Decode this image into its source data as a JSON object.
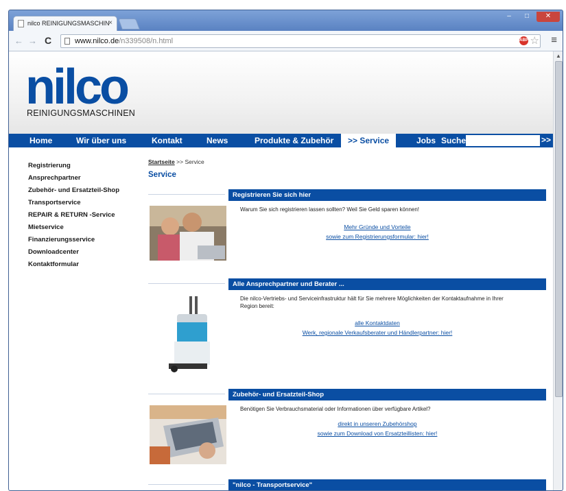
{
  "browser": {
    "tab_title": "nilco REINIGUNGSMASCHIN",
    "tab_close": "×",
    "url_host": "www.nilco.de",
    "url_path": "/n339508/n.html",
    "window_min": "–",
    "window_max": "□",
    "window_close": "✕"
  },
  "logo": {
    "word": "nilco",
    "sub": "REINIGUNGSMASCHINEN"
  },
  "mainnav": {
    "items": [
      "Home",
      "Wir über uns",
      "Kontakt",
      "News",
      "Produkte & Zubehör",
      ">> Service",
      "Jobs",
      "Suche"
    ],
    "search_go": ">>"
  },
  "sidenav": {
    "items": [
      "Registrierung",
      "Ansprechpartner",
      "Zubehör- und Ersatzteil-Shop",
      "Transportservice",
      "REPAIR & RETURN -Service",
      "Mietservice",
      "Finanzierungsservice",
      "Downloadcenter",
      "Kontaktformular"
    ]
  },
  "breadcrumb": {
    "home": "Startseite",
    "sep": ">>",
    "current": "Service"
  },
  "page_title": "Service",
  "sections": [
    {
      "title": "Registrieren Sie sich hier",
      "text": "Warum Sie sich registrieren lassen sollten? Weil Sie Geld sparen können!",
      "links": [
        "Mehr Gründe und Vorteile",
        "sowie zum Registrierungsformular: hier!"
      ]
    },
    {
      "title": "Alle Ansprechpartner und Berater ...",
      "text": "Die nilco-Vertriebs- und Serviceinfrastruktur hält für Sie mehrere Möglichkeiten der Kontaktaufnahme in Ihrer Region bereit:",
      "links": [
        "alle Kontaktdaten",
        "Werk, regionale Verkaufsberater und Händlerpartner: hier!"
      ]
    },
    {
      "title": "Zubehör- und Ersatzteil-Shop",
      "text": "Benötigen Sie Verbrauchsmaterial oder Informationen über verfügbare Artikel?",
      "links": [
        "direkt in unseren Zubehörshop",
        "sowie zum Download von Ersatzteillisten: hier!"
      ]
    },
    {
      "title": "\"nilco - Transportservice\"",
      "text": "",
      "links": []
    }
  ],
  "colors": {
    "brand": "#0a4ea3",
    "chrome": "#5b7fb6"
  }
}
